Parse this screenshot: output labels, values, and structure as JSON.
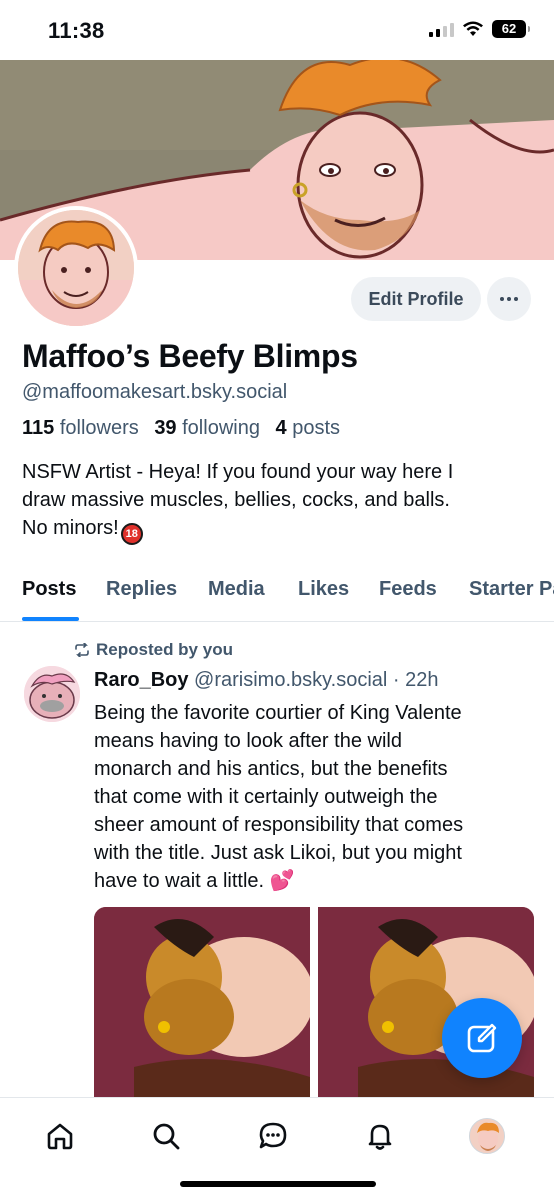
{
  "status": {
    "time": "11:38",
    "battery": "62"
  },
  "profile": {
    "display_name": "Maffoo’s Beefy Blimps",
    "handle": "@maffoomakesart.bsky.social",
    "stats": {
      "followers_count": "115",
      "followers_label": "followers",
      "following_count": "39",
      "following_label": "following",
      "posts_count": "4",
      "posts_label": "posts"
    },
    "bio_lines": [
      "NSFW Artist - Heya! If you found your way here I",
      "draw massive muscles, bellies, cocks, and balls.",
      "No minors!"
    ],
    "bio_badge": "18",
    "edit_label": "Edit Profile"
  },
  "tabs": [
    "Posts",
    "Replies",
    "Media",
    "Likes",
    "Feeds",
    "Starter Packs"
  ],
  "active_tab": "Posts",
  "post": {
    "repost_label": "Reposted by you",
    "author_name": "Raro_Boy",
    "author_meta": "@rarisimo.bsky.social · 22h",
    "body_lines": [
      "Being the favorite courtier of King Valente",
      "means having to look after the wild",
      "monarch and his antics, but the benefits",
      "that come with it certainly outweigh the",
      "sheer amount of responsibility that comes",
      "with the title. Just ask Likoi, but you might",
      "have to wait a little."
    ],
    "emoji": "💕"
  },
  "nav": {
    "items": [
      "home-icon",
      "search-icon",
      "chat-icon",
      "bell-icon",
      "profile-avatar"
    ]
  },
  "colors": {
    "accent": "#1083fe",
    "secondary_text": "#42576c",
    "button_bg": "#eef1f4"
  }
}
